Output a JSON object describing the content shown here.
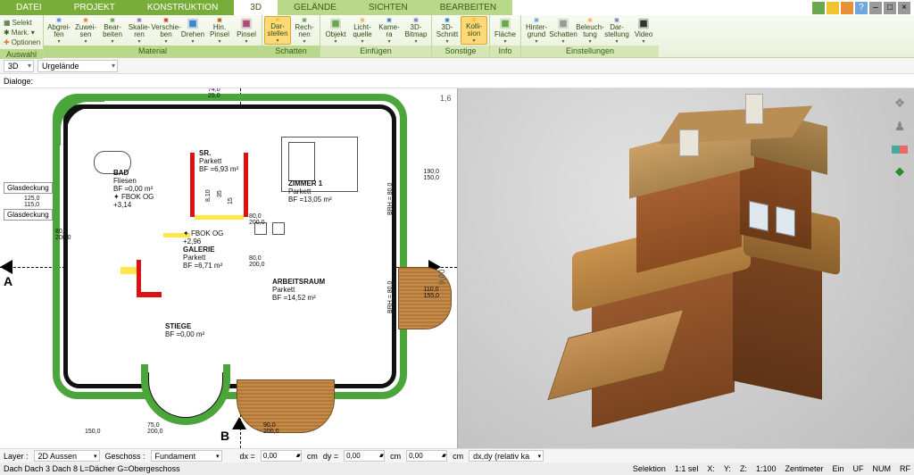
{
  "menu": {
    "tabs": [
      "DATEI",
      "PROJEKT",
      "KONSTRUKTION",
      "3D",
      "GELÄNDE",
      "SICHTEN",
      "BEARBEITEN"
    ],
    "active_index": 3
  },
  "title_icons": [
    "grid",
    "layers",
    "orange",
    "help",
    "min",
    "max",
    "close"
  ],
  "ribbon": {
    "auswahl": {
      "header": "Auswahl",
      "selekt": "Selekt",
      "mark": "Mark.",
      "optionen": "Optionen"
    },
    "material": {
      "header": "Material",
      "btns": [
        {
          "l": "Abgrei-\nfen"
        },
        {
          "l": "Zuwei-\nsen"
        },
        {
          "l": "Bear-\nbeiten"
        },
        {
          "l": "Skalie-\nren"
        },
        {
          "l": "Verschie-\nben"
        },
        {
          "l": "Drehen"
        },
        {
          "l": "Hin.\nPinsel"
        },
        {
          "l": "Pinsel"
        }
      ]
    },
    "schatten": {
      "header": "Schatten",
      "btns": [
        {
          "l": "Dar-\nstellen",
          "active": true
        },
        {
          "l": "Rech-\nnen"
        }
      ]
    },
    "einfuegen": {
      "header": "Einfügen",
      "btns": [
        {
          "l": "Objekt"
        },
        {
          "l": "Licht-\nquelle"
        },
        {
          "l": "Kame-\nra"
        },
        {
          "l": "3D-\nBitmap"
        }
      ]
    },
    "sonstige": {
      "header": "Sonstige",
      "btns": [
        {
          "l": "3D-\nSchnitt"
        },
        {
          "l": "Kolli-\nsion",
          "active": true
        }
      ]
    },
    "info": {
      "header": "Info",
      "btns": [
        {
          "l": "Fläche"
        }
      ]
    },
    "einstellungen": {
      "header": "Einstellungen",
      "btns": [
        {
          "l": "Hinter-\ngrund"
        },
        {
          "l": "Schatten"
        },
        {
          "l": "Beleuch-\ntung"
        },
        {
          "l": "Dar-\nstellung"
        },
        {
          "l": "Video"
        }
      ]
    }
  },
  "nav": {
    "view": "3D",
    "layer": "Urgelände"
  },
  "dialoge_label": "Dialoge:",
  "plan": {
    "glass1": "Glasdeckung",
    "glass2": "Glasdeckung",
    "bad": {
      "name": "BAD",
      "mat": "Fliesen",
      "area": "BF =0,00 m²",
      "note": "FBOK OG",
      "elev": "+3,14"
    },
    "sr": {
      "name": "SR.",
      "mat": "Parkett",
      "area": "BF =6,93 m²"
    },
    "zimmer": {
      "name": "ZIMMER 1",
      "mat": "Parkett",
      "area": "BF =13,05 m²"
    },
    "galerie": {
      "name": "GALERIE",
      "mat": "Parkett",
      "area": "BF =6,71 m²",
      "note": "FBOK OG",
      "elev": "+2,96"
    },
    "arbeit": {
      "name": "ARBEITSRAUM",
      "mat": "Parkett",
      "area": "BF =14,52 m²"
    },
    "stiege": {
      "name": "STIEGE",
      "area": "BF =0,00 m²"
    },
    "sec_a": "A",
    "sec_b": "B",
    "dims": {
      "d1": "125,0",
      "d1b": "115,0",
      "d2": "80,0",
      "d2b": "200,0",
      "d3": "190,0",
      "d3b": "150,0",
      "d4": "110,0",
      "d4b": "155,0",
      "d5": "150,0",
      "d6": "75,0",
      "d6b": "200,0",
      "d7": "90,0",
      "d7b": "200,0",
      "t1": "74,0",
      "t1b": "25,0",
      "t2": "35",
      "t3": "8,10",
      "t4": "15",
      "t5": "80,0",
      "t5b": "200,0",
      "t6": "80,0",
      "t6b": "200,0",
      "brh": "BRH = 80,0",
      "side9": "9,00",
      "side16": "1,6"
    }
  },
  "right_tools": [
    "layers",
    "chair",
    "palette",
    "tree"
  ],
  "bottom": {
    "layer_lbl": "Layer :",
    "layer_val": "2D Aussen",
    "geschoss_lbl": "Geschoss :",
    "geschoss_val": "Fundament",
    "dx": "dx =",
    "dy": "dy =",
    "cm": "cm",
    "v1": "0,00",
    "v2": "0,00",
    "v3": "0,00",
    "dxdy": "dx,dy (relativ ka"
  },
  "status": {
    "left": "Dach Dach 3 Dach 8 L=Dächer G=Obergeschoss",
    "sel": "Selektion",
    "sel_v": "1:1 sel",
    "x": "X:",
    "y": "Y:",
    "z": "Z:",
    "scale": "1:100",
    "unit": "Zentimeter",
    "ein": "Ein",
    "uf": "UF",
    "num": "NUM",
    "rf": "RF"
  }
}
